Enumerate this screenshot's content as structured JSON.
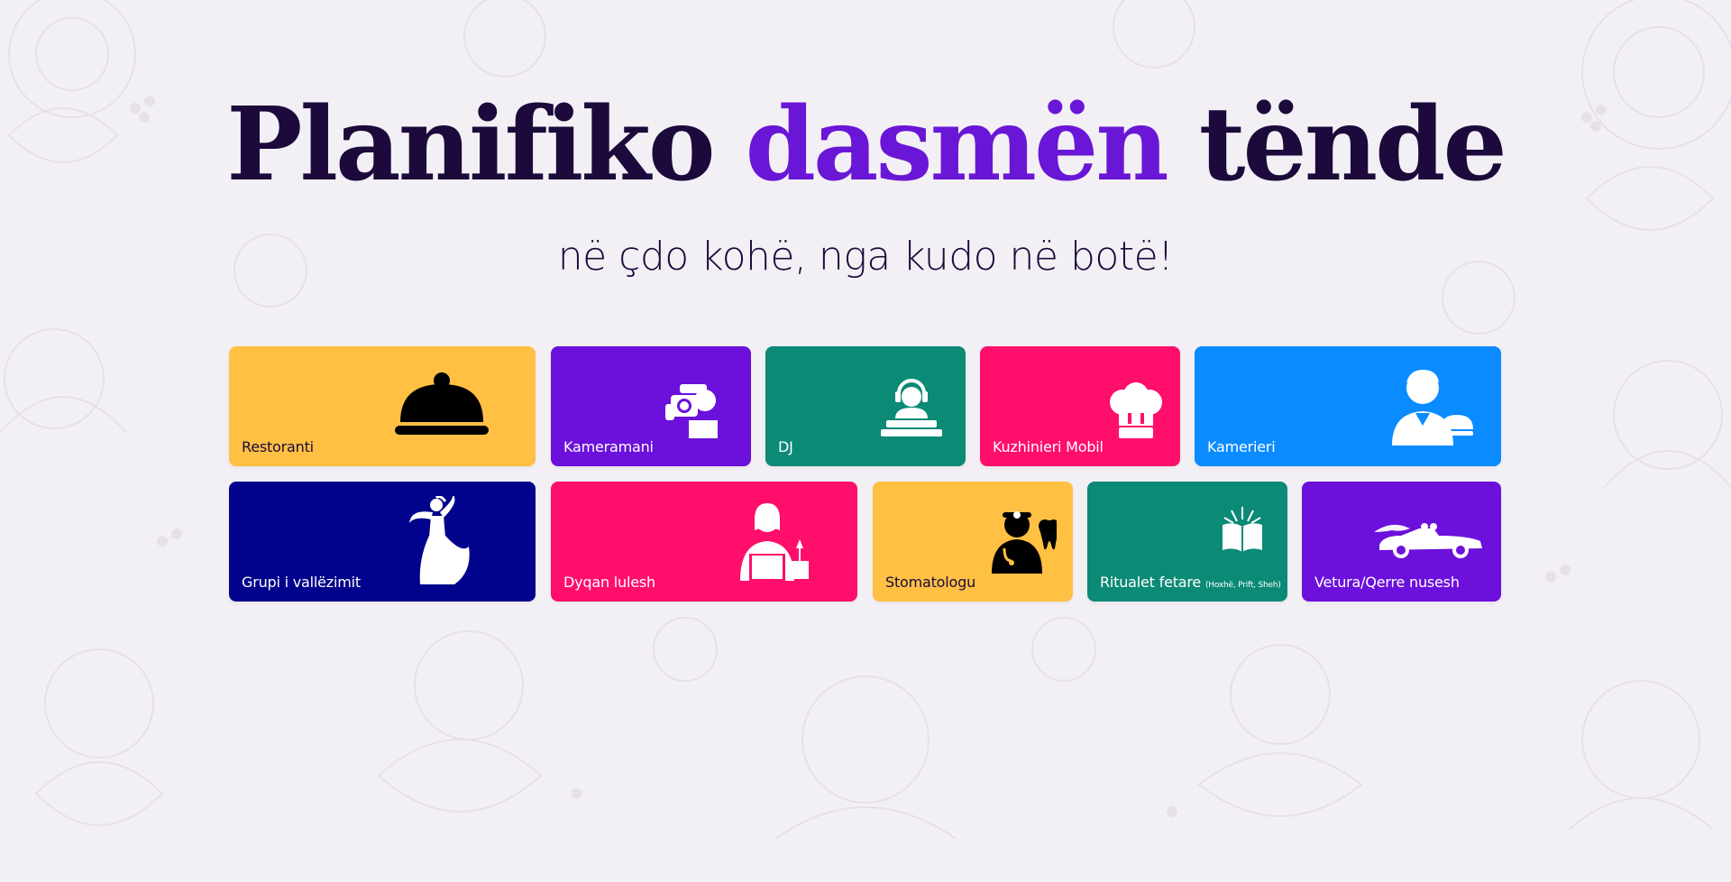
{
  "hero": {
    "title_part1": "Planifiko",
    "title_accent": "dasmën",
    "title_part2": "tënde",
    "subtitle": "në çdo kohë, nga kudo në botë!"
  },
  "colors": {
    "background": "#f3f0f5",
    "title": "#1b0a3b",
    "accent": "#6a16d6",
    "yellow": "#ffc043",
    "purple": "#6c10dc",
    "teal": "#0b8a76",
    "pink": "#ff0e6b",
    "blue": "#0a8bff",
    "navy": "#01038c"
  },
  "tiles": [
    {
      "label": "Restoranti",
      "icon": "cloche-icon",
      "color": "#ffc043"
    },
    {
      "label": "Kameramani",
      "icon": "cameraman-icon",
      "color": "#6c10dc"
    },
    {
      "label": "DJ",
      "icon": "dj-icon",
      "color": "#0b8a76"
    },
    {
      "label": "Kuzhinieri Mobil",
      "icon": "chef-hat-icon",
      "color": "#ff0e6b"
    },
    {
      "label": "Kamerieri",
      "icon": "waiter-icon",
      "color": "#0a8bff"
    },
    {
      "label": "Grupi i vallëzimit",
      "icon": "dancer-icon",
      "color": "#01038c"
    },
    {
      "label": "Dyqan lulesh",
      "icon": "florist-icon",
      "color": "#ff0e6b"
    },
    {
      "label": "Stomatologu",
      "icon": "dentist-icon",
      "color": "#ffc043"
    },
    {
      "label": "Ritualet fetare",
      "label_note": "(Hoxhë, Prift, Sheh)",
      "icon": "holy-book-icon",
      "color": "#0b8a76"
    },
    {
      "label": "Vetura/Qerre nusesh",
      "icon": "wedding-car-icon",
      "color": "#6c10dc"
    }
  ]
}
